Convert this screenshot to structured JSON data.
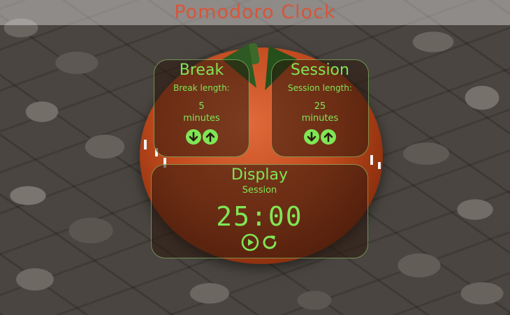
{
  "title": "Pomodoro Clock",
  "break": {
    "title": "Break",
    "length_label": "Break length:",
    "value": "5",
    "unit": "minutes"
  },
  "session": {
    "title": "Session",
    "length_label": "Session length:",
    "value": "25",
    "unit": "minutes"
  },
  "display": {
    "title": "Display",
    "mode": "Session",
    "time": "25:00"
  },
  "colors": {
    "accent": "#7fe655",
    "title": "#d7553a",
    "tomato": "#c04a1e"
  },
  "icons": {
    "decrement": "arrow-down-circle-icon",
    "increment": "arrow-up-circle-icon",
    "play": "play-circle-icon",
    "reset": "refresh-icon"
  }
}
